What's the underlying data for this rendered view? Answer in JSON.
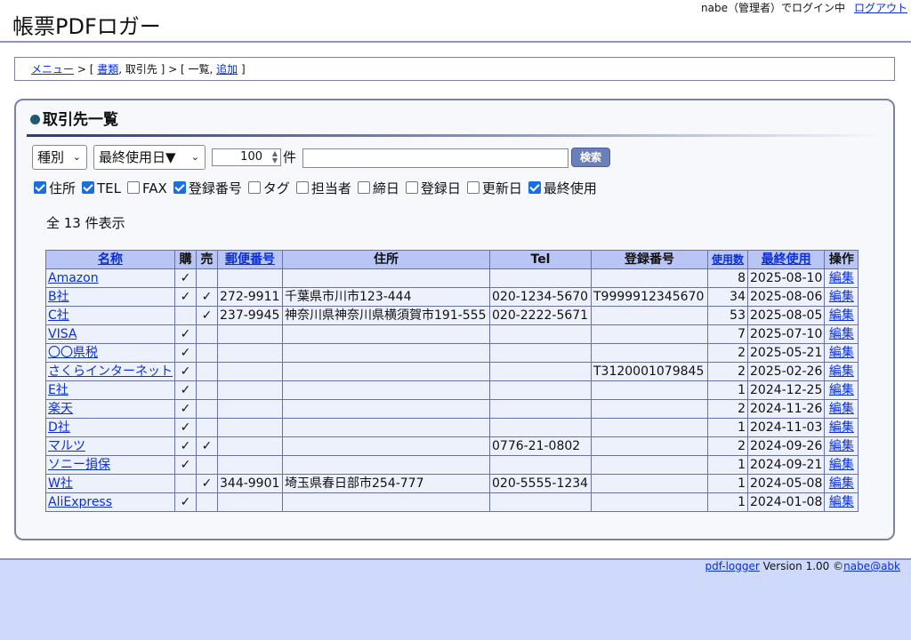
{
  "header": {
    "app_title": "帳票PDFロガー",
    "login_status": "nabe（管理者）でログイン中",
    "logout_link": "ログアウト"
  },
  "breadcrumb": {
    "menu": "メニュー",
    "sep1": " > [ ",
    "documents": "書類",
    "current": ", 取引先 ] > [ 一覧, ",
    "add": "追加",
    "end": " ]"
  },
  "panel": {
    "title": "取引先一覧",
    "filter": {
      "type_select": "種別",
      "sort_select": "最終使用日▼",
      "count_value": "100",
      "count_unit": "件",
      "search_value": "",
      "search_button": "検索"
    },
    "columns": [
      {
        "label": "住所",
        "checked": true
      },
      {
        "label": "TEL",
        "checked": true
      },
      {
        "label": "FAX",
        "checked": false
      },
      {
        "label": "登録番号",
        "checked": true
      },
      {
        "label": "タグ",
        "checked": false
      },
      {
        "label": "担当者",
        "checked": false
      },
      {
        "label": "締日",
        "checked": false
      },
      {
        "label": "登録日",
        "checked": false
      },
      {
        "label": "更新日",
        "checked": false
      },
      {
        "label": "最終使用",
        "checked": true
      }
    ],
    "result_count": "全 13 件表示"
  },
  "table": {
    "headers": {
      "name": "名称",
      "buy": "購",
      "sell": "売",
      "postal": "郵便番号",
      "address": "住所",
      "tel": "Tel",
      "reg": "登録番号",
      "usage": "使用数",
      "last": "最終使用",
      "action": "操作"
    },
    "edit_label": "編集",
    "rows": [
      {
        "name": "Amazon",
        "buy": "✓",
        "sell": "",
        "postal": "",
        "address": "",
        "tel": "",
        "reg": "",
        "usage": "8",
        "last": "2025-08-10"
      },
      {
        "name": "B社",
        "buy": "✓",
        "sell": "✓",
        "postal": "272-9911",
        "address": "千葉県市川市123-444",
        "tel": "020-1234-5670",
        "reg": "T9999912345670",
        "usage": "34",
        "last": "2025-08-06"
      },
      {
        "name": "C社",
        "buy": "",
        "sell": "✓",
        "postal": "237-9945",
        "address": "神奈川県神奈川県横須賀市191-555",
        "tel": "020-2222-5671",
        "reg": "",
        "usage": "53",
        "last": "2025-08-05"
      },
      {
        "name": "VISA",
        "buy": "✓",
        "sell": "",
        "postal": "",
        "address": "",
        "tel": "",
        "reg": "",
        "usage": "7",
        "last": "2025-07-10"
      },
      {
        "name": "〇〇県税",
        "buy": "✓",
        "sell": "",
        "postal": "",
        "address": "",
        "tel": "",
        "reg": "",
        "usage": "2",
        "last": "2025-05-21"
      },
      {
        "name": "さくらインターネット",
        "buy": "✓",
        "sell": "",
        "postal": "",
        "address": "",
        "tel": "",
        "reg": "T3120001079845",
        "usage": "2",
        "last": "2025-02-26"
      },
      {
        "name": "E社",
        "buy": "✓",
        "sell": "",
        "postal": "",
        "address": "",
        "tel": "",
        "reg": "",
        "usage": "1",
        "last": "2024-12-25"
      },
      {
        "name": "楽天",
        "buy": "✓",
        "sell": "",
        "postal": "",
        "address": "",
        "tel": "",
        "reg": "",
        "usage": "2",
        "last": "2024-11-26"
      },
      {
        "name": "D社",
        "buy": "✓",
        "sell": "",
        "postal": "",
        "address": "",
        "tel": "",
        "reg": "",
        "usage": "1",
        "last": "2024-11-03"
      },
      {
        "name": "マルツ",
        "buy": "✓",
        "sell": "✓",
        "postal": "",
        "address": "",
        "tel": "0776-21-0802",
        "reg": "",
        "usage": "2",
        "last": "2024-09-26"
      },
      {
        "name": "ソニー損保",
        "buy": "✓",
        "sell": "",
        "postal": "",
        "address": "",
        "tel": "",
        "reg": "",
        "usage": "1",
        "last": "2024-09-21"
      },
      {
        "name": "W社",
        "buy": "",
        "sell": "✓",
        "postal": "344-9901",
        "address": "埼玉県春日部市254-777",
        "tel": "020-5555-1234",
        "reg": "",
        "usage": "1",
        "last": "2024-05-08"
      },
      {
        "name": "AliExpress",
        "buy": "✓",
        "sell": "",
        "postal": "",
        "address": "",
        "tel": "",
        "reg": "",
        "usage": "1",
        "last": "2024-01-08"
      }
    ]
  },
  "footer": {
    "app_link": "pdf-logger",
    "version": " Version 1.00 ©",
    "author_link": "nabe@abk"
  }
}
